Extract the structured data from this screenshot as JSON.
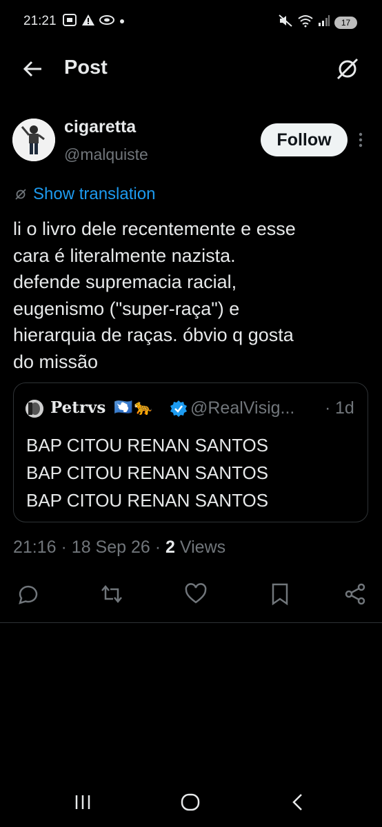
{
  "status_bar": {
    "time": "21:21",
    "battery": "17",
    "left_icons": [
      "screenshot-icon",
      "alert-icon",
      "notification-app-icon",
      "dot-icon"
    ],
    "right_icons": [
      "mute-icon",
      "wifi-icon",
      "signal-icon",
      "battery-icon"
    ]
  },
  "header": {
    "title": "Post"
  },
  "post": {
    "author": {
      "display_name": "cigaretta",
      "handle": "@malquiste"
    },
    "follow_label": "Follow",
    "show_translation": "Show translation",
    "text": "li o livro dele recentemente e esse\ncara é literalmente nazista.\ndefende supremacia racial,\neugenismo (\"super-raça\") e\nhierarquia de raças. óbvio q gosta\ndo missão",
    "quote": {
      "display_name": "Petrvs",
      "flag_emojis": [
        "🇦🇶",
        "🐆"
      ],
      "verified": true,
      "handle": "@RealVisig...",
      "separator": "·",
      "age": "1d",
      "text": "BAP CITOU RENAN SANTOS\nBAP CITOU RENAN SANTOS\nBAP CITOU RENAN SANTOS"
    },
    "meta": {
      "time": "21:16",
      "sep1": "·",
      "date": "18 Sep 26",
      "sep2": "·",
      "views_count": "2",
      "views_label": "Views"
    }
  },
  "actions": [
    "reply-icon",
    "repost-icon",
    "like-icon",
    "bookmark-icon",
    "share-icon"
  ],
  "colors": {
    "background": "#000000",
    "text": "#e7e9ea",
    "secondary": "#71767b",
    "link": "#1d9bf0",
    "border": "#2f3336",
    "follow_bg": "#eff3f4"
  }
}
